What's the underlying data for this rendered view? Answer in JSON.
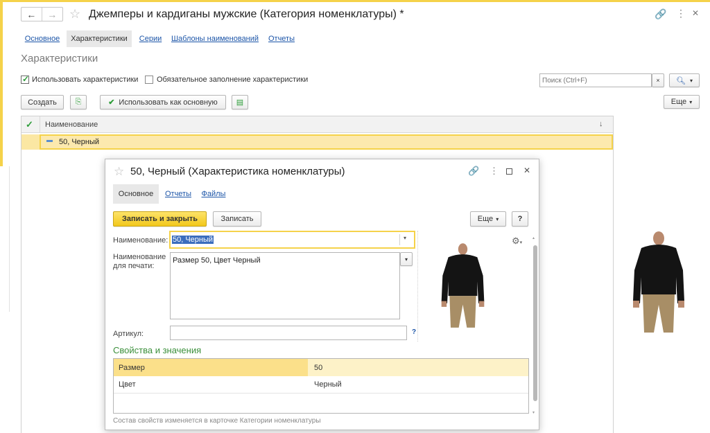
{
  "main": {
    "title": "Джемперы и кардиганы мужские (Категория номенклатуры) *",
    "nav_back": "←",
    "nav_fwd": "→",
    "tabs": [
      {
        "label": "Основное"
      },
      {
        "label": "Характеристики"
      },
      {
        "label": "Серии"
      },
      {
        "label": "Шаблоны наименований"
      },
      {
        "label": "Отчеты"
      }
    ],
    "section_title": "Характеристики",
    "use_chars_label": "Использовать характеристики",
    "use_chars_checked": true,
    "required_fill_label": "Обязательное заполнение характеристики",
    "required_fill_checked": false,
    "search_placeholder": "Поиск (Ctrl+F)",
    "create_label": "Создать",
    "use_as_main_label": "Использовать как основную",
    "more_label": "Еще",
    "table": {
      "column_name": "Наименование",
      "sort_indicator": "↓",
      "rows": [
        {
          "name": "50, Черный"
        }
      ]
    }
  },
  "dialog": {
    "title": "50, Черный (Характеристика номенклатуры)",
    "tabs": [
      {
        "label": "Основное"
      },
      {
        "label": "Отчеты"
      },
      {
        "label": "Файлы"
      }
    ],
    "save_close_label": "Записать и закрыть",
    "save_label": "Записать",
    "more_label": "Еще",
    "help_label": "?",
    "name_label": "Наименование:",
    "name_value": "50, Черный",
    "print_name_label_1": "Наименование",
    "print_name_label_2": "для печати:",
    "print_name_value": "Размер 50, Цвет Черный",
    "article_label": "Артикул:",
    "article_value": "",
    "article_help": "?",
    "props_title": "Свойства и значения",
    "props": [
      {
        "name": "Размер",
        "value": "50"
      },
      {
        "name": "Цвет",
        "value": "Черный"
      }
    ],
    "footer_note": "Состав свойств изменяется в карточке Категории номенклатуры"
  },
  "colors": {
    "accent_yellow": "#f5d24a",
    "row_highlight": "#fbe7a3",
    "selected_row": "#fce9ae",
    "link": "#1c55a8",
    "green": "#2e9d3a",
    "props_title": "#3a8f3a"
  }
}
